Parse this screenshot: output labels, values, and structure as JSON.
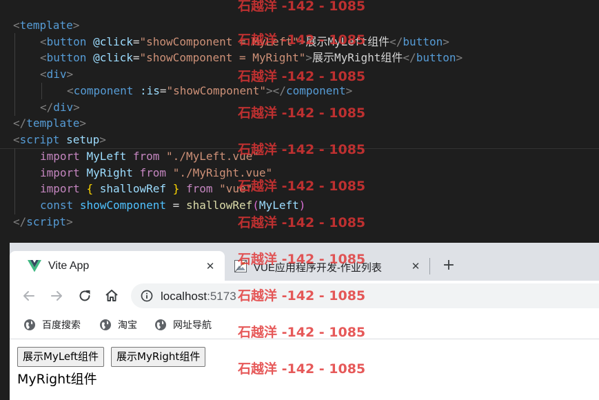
{
  "editor": {
    "lines": [
      [
        [
          "t-punc",
          "<"
        ],
        [
          "t-tag",
          "template"
        ],
        [
          "t-punc",
          ">"
        ]
      ],
      [
        [
          "t-punc",
          "<"
        ],
        [
          "t-tag",
          "button"
        ],
        [
          "t-txt",
          " "
        ],
        [
          "t-attr",
          "@click"
        ],
        [
          "t-txt",
          "="
        ],
        [
          "t-str",
          "\"showComponent = MyLeft\""
        ],
        [
          "t-punc",
          ">"
        ],
        [
          "t-txt",
          "展示MyLeft组件"
        ],
        [
          "t-punc",
          "</"
        ],
        [
          "t-tag",
          "button"
        ],
        [
          "t-punc",
          ">"
        ]
      ],
      [
        [
          "t-punc",
          "<"
        ],
        [
          "t-tag",
          "button"
        ],
        [
          "t-txt",
          " "
        ],
        [
          "t-attr",
          "@click"
        ],
        [
          "t-txt",
          "="
        ],
        [
          "t-str",
          "\"showComponent = MyRight\""
        ],
        [
          "t-punc",
          ">"
        ],
        [
          "t-txt",
          "展示MyRight组件"
        ],
        [
          "t-punc",
          "</"
        ],
        [
          "t-tag",
          "button"
        ],
        [
          "t-punc",
          ">"
        ]
      ],
      [
        [
          "t-punc",
          "<"
        ],
        [
          "t-tag",
          "div"
        ],
        [
          "t-punc",
          ">"
        ]
      ],
      [
        [
          "t-punc",
          "<"
        ],
        [
          "t-tag",
          "component"
        ],
        [
          "t-txt",
          " "
        ],
        [
          "t-attr",
          ":is"
        ],
        [
          "t-txt",
          "="
        ],
        [
          "t-str",
          "\"showComponent\""
        ],
        [
          "t-punc",
          "></"
        ],
        [
          "t-tag",
          "component"
        ],
        [
          "t-punc",
          ">"
        ]
      ],
      [
        [
          "t-punc",
          "</"
        ],
        [
          "t-tag",
          "div"
        ],
        [
          "t-punc",
          ">"
        ]
      ],
      [
        [
          "t-punc",
          "</"
        ],
        [
          "t-tag",
          "template"
        ],
        [
          "t-punc",
          ">"
        ]
      ],
      [
        [
          "t-punc",
          "<"
        ],
        [
          "t-tag",
          "script"
        ],
        [
          "t-txt",
          " "
        ],
        [
          "t-attr",
          "setup"
        ],
        [
          "t-punc",
          ">"
        ]
      ],
      [
        [
          "t-kw",
          "import"
        ],
        [
          "t-txt",
          " "
        ],
        [
          "t-var",
          "MyLeft"
        ],
        [
          "t-txt",
          " "
        ],
        [
          "t-kw",
          "from"
        ],
        [
          "t-txt",
          " "
        ],
        [
          "t-str",
          "\"./MyLeft.vue\""
        ]
      ],
      [
        [
          "t-kw",
          "import"
        ],
        [
          "t-txt",
          " "
        ],
        [
          "t-var",
          "MyRight"
        ],
        [
          "t-txt",
          " "
        ],
        [
          "t-kw",
          "from"
        ],
        [
          "t-txt",
          " "
        ],
        [
          "t-str",
          "\"./MyRight.vue\""
        ]
      ],
      [
        [
          "t-kw",
          "import"
        ],
        [
          "t-txt",
          " "
        ],
        [
          "t-br1",
          "{"
        ],
        [
          "t-txt",
          " "
        ],
        [
          "t-var",
          "shallowRef"
        ],
        [
          "t-txt",
          " "
        ],
        [
          "t-br1",
          "}"
        ],
        [
          "t-txt",
          " "
        ],
        [
          "t-kw",
          "from"
        ],
        [
          "t-txt",
          " "
        ],
        [
          "t-str",
          "\"vue\""
        ]
      ],
      [
        [
          "t-decl",
          "const"
        ],
        [
          "t-txt",
          " "
        ],
        [
          "t-const",
          "showComponent"
        ],
        [
          "t-txt",
          " = "
        ],
        [
          "t-fn",
          "shallowRef"
        ],
        [
          "t-br2",
          "("
        ],
        [
          "t-var",
          "MyLeft"
        ],
        [
          "t-br2",
          ")"
        ]
      ],
      [
        [
          "t-punc",
          "</"
        ],
        [
          "t-tag",
          "script"
        ],
        [
          "t-punc",
          ">"
        ]
      ]
    ]
  },
  "browser": {
    "tabs": [
      {
        "title": "Vite App",
        "icon": "vue-logo-icon",
        "active": true
      },
      {
        "title": "VUE应用程序开发-作业列表",
        "icon": "broken-image-icon",
        "active": false
      }
    ],
    "new_tab_label": "+",
    "close_glyph": "✕",
    "address": {
      "host": "localhost",
      "port": ":5173"
    },
    "bookmarks": [
      {
        "label": "百度搜索",
        "icon": "globe-icon"
      },
      {
        "label": "淘宝",
        "icon": "globe-icon"
      },
      {
        "label": "网址导航",
        "icon": "globe-icon"
      }
    ]
  },
  "page": {
    "buttons": [
      "展示MyLeft组件",
      "展示MyRight组件"
    ],
    "content_text": "MyRight组件"
  },
  "watermark": "石越洋 -142 - 1085",
  "colors": {
    "editor_bg": "#1e1e1e",
    "tab_strip": "#dee1e6",
    "vue_green": "#41b883",
    "vue_dark": "#35495e",
    "watermark_red": "#e03434"
  }
}
